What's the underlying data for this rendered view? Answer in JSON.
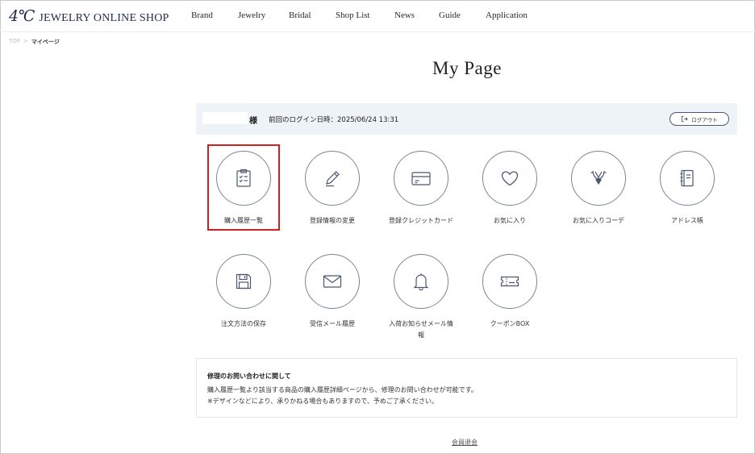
{
  "header": {
    "logo_mark": "4℃",
    "logo_text": "JEWELRY ONLINE SHOP",
    "nav": [
      "Brand",
      "Jewelry",
      "Bridal",
      "Shop List",
      "News",
      "Guide",
      "Application"
    ]
  },
  "breadcrumb": {
    "top": "TOP",
    "separator": ">",
    "current": "マイページ"
  },
  "page_title": "My Page",
  "login_bar": {
    "honorific": "様",
    "last_login": "前回のログイン日時：2025/06/24 13:31",
    "logout_label": "ログアウト"
  },
  "menu": [
    {
      "label": "購入履歴一覧",
      "icon": "clipboard-checklist-icon",
      "highlighted": true
    },
    {
      "label": "登録情報の変更",
      "icon": "pencil-icon"
    },
    {
      "label": "登録クレジットカード",
      "icon": "credit-card-icon"
    },
    {
      "label": "お気に入り",
      "icon": "heart-icon"
    },
    {
      "label": "お気に入りコーデ",
      "icon": "necklace-icon"
    },
    {
      "label": "アドレス帳",
      "icon": "address-book-icon"
    },
    {
      "label": "注文方法の保存",
      "icon": "floppy-disk-icon"
    },
    {
      "label": "受信メール履歴",
      "icon": "envelope-icon"
    },
    {
      "label": "入荷お知らせメール情報",
      "icon": "bell-icon"
    },
    {
      "label": "クーポンBOX",
      "icon": "coupon-ticket-icon"
    }
  ],
  "notice": {
    "title": "修理のお問い合わせに関して",
    "line1": "購入履歴一覧より該当する商品の購入履歴詳細ページから、修理のお問い合わせが可能です。",
    "line2": "※デザインなどにより、承りかねる場合もありますので、予めご了承ください。"
  },
  "withdraw_link": "会員退会",
  "colors": {
    "highlight": "#d21f1f",
    "login_bar_bg": "#eef3f8",
    "icon_stroke": "#4b5670"
  }
}
